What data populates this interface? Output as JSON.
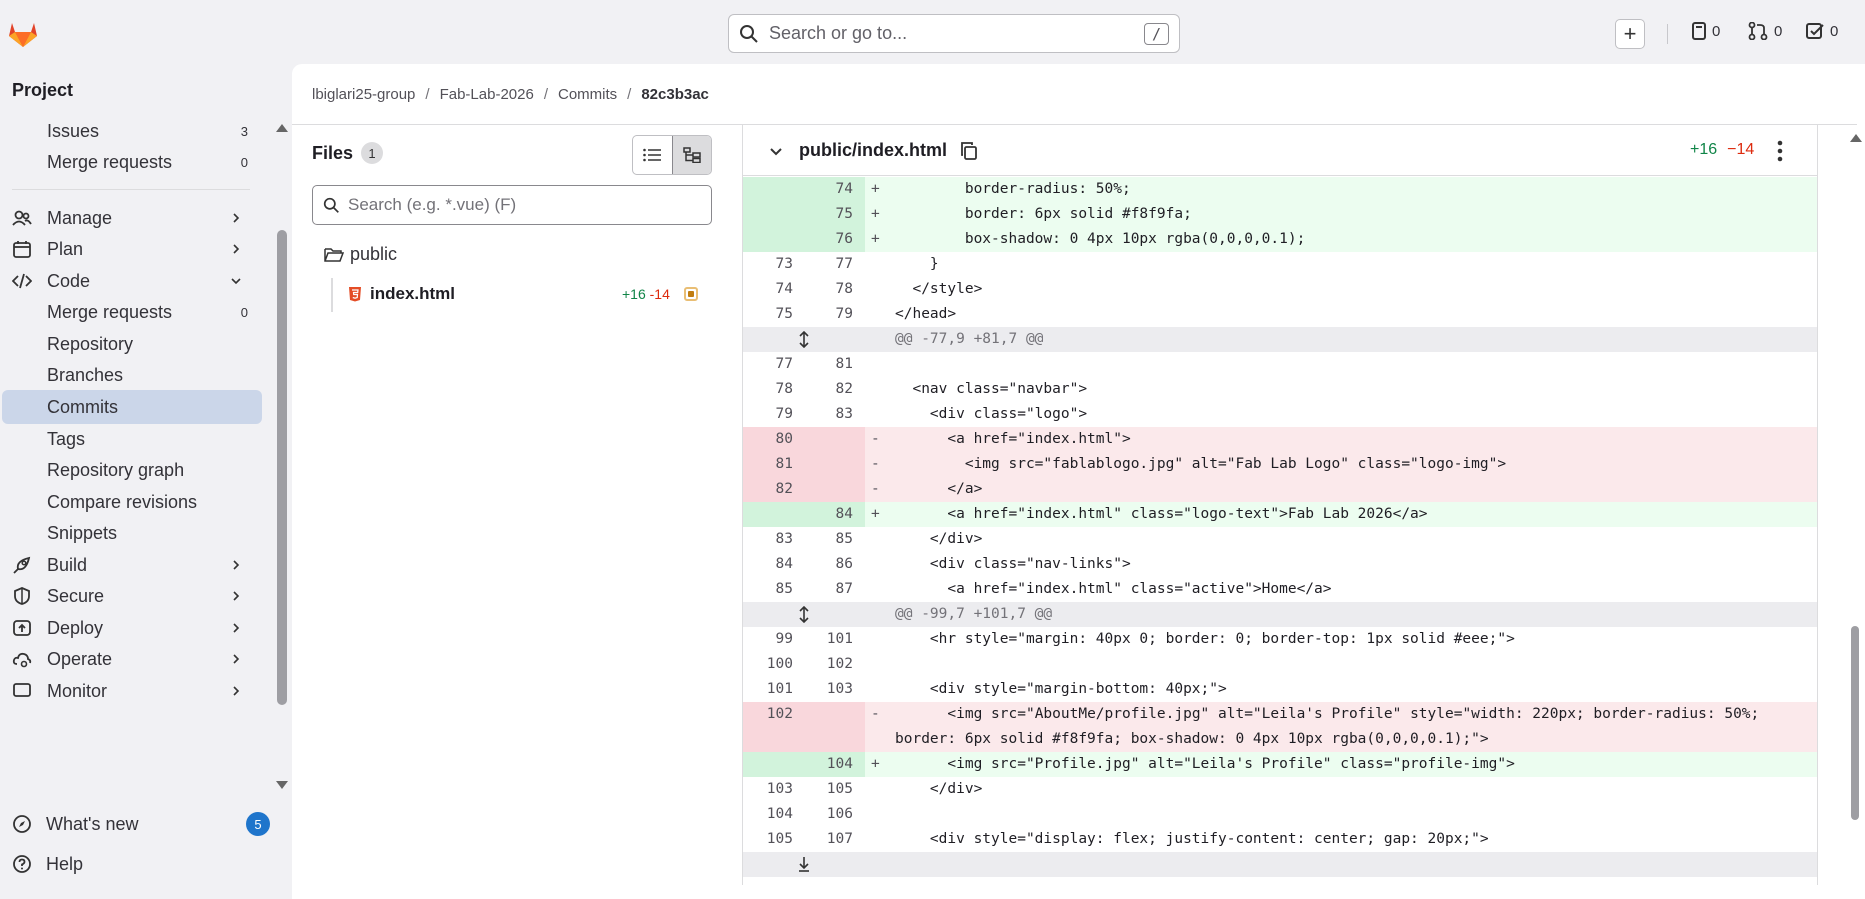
{
  "search": {
    "placeholder": "Search or go to...",
    "shortcut": "/"
  },
  "top": {
    "counters": [
      {
        "icon": "issues-icon",
        "value": "0"
      },
      {
        "icon": "merge-request-icon",
        "value": "0"
      },
      {
        "icon": "todo-icon",
        "value": "0"
      }
    ]
  },
  "sidebar": {
    "title": "Project",
    "items": [
      {
        "label": "Issues",
        "count": "3"
      },
      {
        "label": "Merge requests",
        "count": "0"
      },
      {
        "label": "Manage"
      },
      {
        "label": "Plan"
      },
      {
        "label": "Code"
      },
      {
        "label": "Merge requests",
        "count": "0"
      },
      {
        "label": "Repository"
      },
      {
        "label": "Branches"
      },
      {
        "label": "Commits"
      },
      {
        "label": "Tags"
      },
      {
        "label": "Repository graph"
      },
      {
        "label": "Compare revisions"
      },
      {
        "label": "Snippets"
      },
      {
        "label": "Build"
      },
      {
        "label": "Secure"
      },
      {
        "label": "Deploy"
      },
      {
        "label": "Operate"
      },
      {
        "label": "Monitor"
      }
    ],
    "whats_new": "What's new",
    "whats_new_count": "5",
    "help": "Help"
  },
  "breadcrumb": {
    "group": "lbiglari25-group",
    "project": "Fab-Lab-2026",
    "commits": "Commits",
    "sha": "82c3b3ac"
  },
  "files": {
    "title": "Files",
    "count": "1",
    "search_placeholder": "Search (e.g. *.vue) (F)",
    "folder": "public",
    "file": "index.html",
    "file_added": "+16",
    "file_removed": "-14"
  },
  "diff": {
    "path": "public/index.html",
    "added": "+16",
    "removed": "−14",
    "lines": [
      {
        "type": "add",
        "o": "",
        "n": "74",
        "code": "        border-radius: 50%;"
      },
      {
        "type": "add",
        "o": "",
        "n": "75",
        "code": "        border: 6px solid #f8f9fa;"
      },
      {
        "type": "add",
        "o": "",
        "n": "76",
        "code": "        box-shadow: 0 4px 10px rgba(0,0,0,0.1);"
      },
      {
        "type": "ctx",
        "o": "73",
        "n": "77",
        "code": "    }"
      },
      {
        "type": "ctx",
        "o": "74",
        "n": "78",
        "code": "  </style>"
      },
      {
        "type": "ctx",
        "o": "75",
        "n": "79",
        "code": "</head>"
      },
      {
        "type": "hunk",
        "o": "",
        "n": "",
        "code": "@@ -77,9 +81,7 @@"
      },
      {
        "type": "ctx",
        "o": "77",
        "n": "81",
        "code": ""
      },
      {
        "type": "ctx",
        "o": "78",
        "n": "82",
        "code": "  <nav class=\"navbar\">"
      },
      {
        "type": "ctx",
        "o": "79",
        "n": "83",
        "code": "    <div class=\"logo\">"
      },
      {
        "type": "del",
        "o": "80",
        "n": "",
        "code": "      <a href=\"index.html\">"
      },
      {
        "type": "del",
        "o": "81",
        "n": "",
        "code": "        <img src=\"fablablogo.jpg\" alt=\"Fab Lab Logo\" class=\"logo-img\">"
      },
      {
        "type": "del",
        "o": "82",
        "n": "",
        "code": "      </a>"
      },
      {
        "type": "add",
        "o": "",
        "n": "84",
        "code": "      <a href=\"index.html\" class=\"logo-text\">Fab Lab 2026</a>"
      },
      {
        "type": "ctx",
        "o": "83",
        "n": "85",
        "code": "    </div>"
      },
      {
        "type": "ctx",
        "o": "84",
        "n": "86",
        "code": "    <div class=\"nav-links\">"
      },
      {
        "type": "ctx",
        "o": "85",
        "n": "87",
        "code": "      <a href=\"index.html\" class=\"active\">Home</a>"
      },
      {
        "type": "hunk",
        "o": "",
        "n": "",
        "code": "@@ -99,7 +101,7 @@"
      },
      {
        "type": "ctx",
        "o": "99",
        "n": "101",
        "code": "    <hr style=\"margin: 40px 0; border: 0; border-top: 1px solid #eee;\">"
      },
      {
        "type": "ctx",
        "o": "100",
        "n": "102",
        "code": ""
      },
      {
        "type": "ctx",
        "o": "101",
        "n": "103",
        "code": "    <div style=\"margin-bottom: 40px;\">"
      },
      {
        "type": "del",
        "o": "102",
        "n": "",
        "code": "      <img src=\"AboutMe/profile.jpg\" alt=\"Leila's Profile\" style=\"width: 220px; border-radius: 50%; border: 6px solid #f8f9fa; box-shadow: 0 4px 10px rgba(0,0,0,0.1);\">"
      },
      {
        "type": "add",
        "o": "",
        "n": "104",
        "code": "      <img src=\"Profile.jpg\" alt=\"Leila's Profile\" class=\"profile-img\">"
      },
      {
        "type": "ctx",
        "o": "103",
        "n": "105",
        "code": "    </div>"
      },
      {
        "type": "ctx",
        "o": "104",
        "n": "106",
        "code": ""
      },
      {
        "type": "ctx",
        "o": "105",
        "n": "107",
        "code": "    <div style=\"display: flex; justify-content: center; gap: 20px;\">"
      },
      {
        "type": "hunk",
        "o": "",
        "n": "",
        "code": ""
      }
    ]
  },
  "colors": {
    "add_bg": "#ecfdf0",
    "del_bg": "#fbe9eb",
    "active_nav": "#cbd6e9",
    "accent": "#1f75cb"
  }
}
